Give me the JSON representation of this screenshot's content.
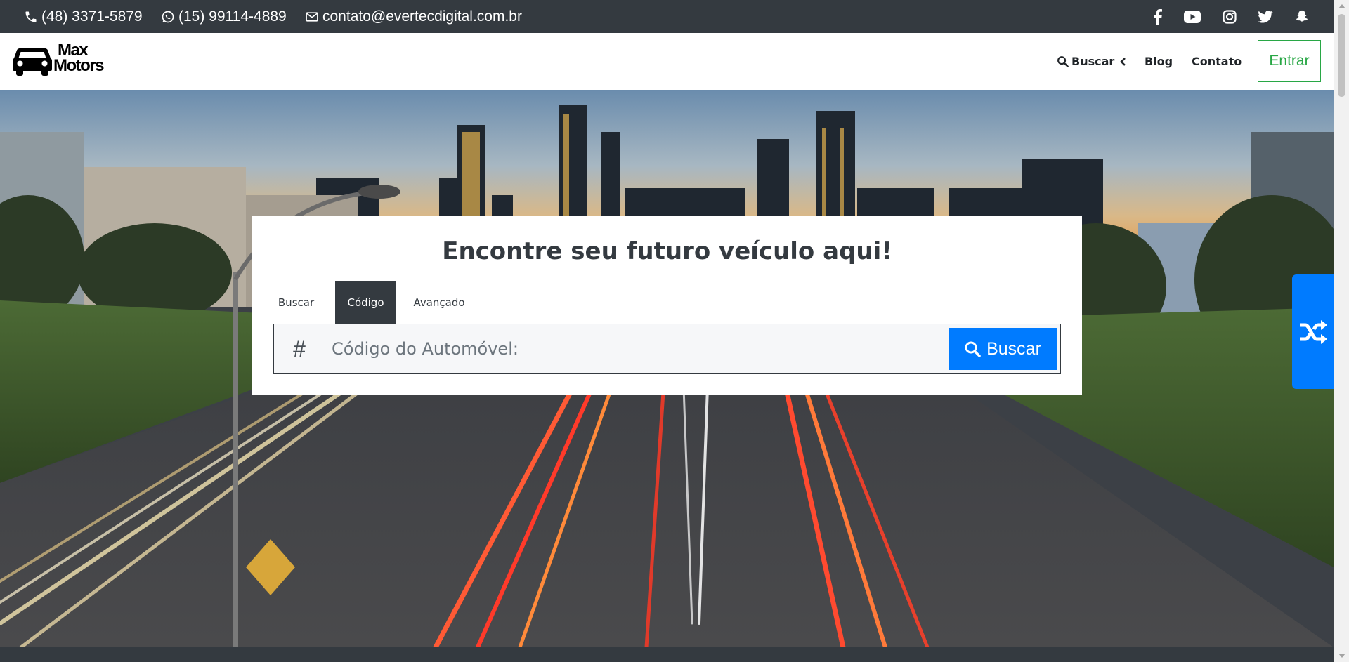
{
  "topbar": {
    "phone": "(48) 3371-5879",
    "whatsapp": "(15) 99114-4889",
    "email": "contato@evertecdigital.com.br",
    "social": [
      "facebook-icon",
      "youtube-icon",
      "instagram-icon",
      "twitter-icon",
      "snapchat-icon"
    ]
  },
  "navbar": {
    "logo_line1": "Max",
    "logo_line2": "Motors",
    "search_label": "Buscar",
    "blog_label": "Blog",
    "contact_label": "Contato",
    "login_label": "Entrar"
  },
  "search": {
    "title": "Encontre seu futuro veículo aqui!",
    "tabs": [
      {
        "label": "Buscar",
        "active": false
      },
      {
        "label": "Código",
        "active": true
      },
      {
        "label": "Avançado",
        "active": false
      }
    ],
    "prefix": "#",
    "placeholder": "Código do Automóvel:",
    "button_label": "Buscar"
  },
  "colors": {
    "dark": "#343a40",
    "primary": "#007bff",
    "success": "#28a745"
  }
}
